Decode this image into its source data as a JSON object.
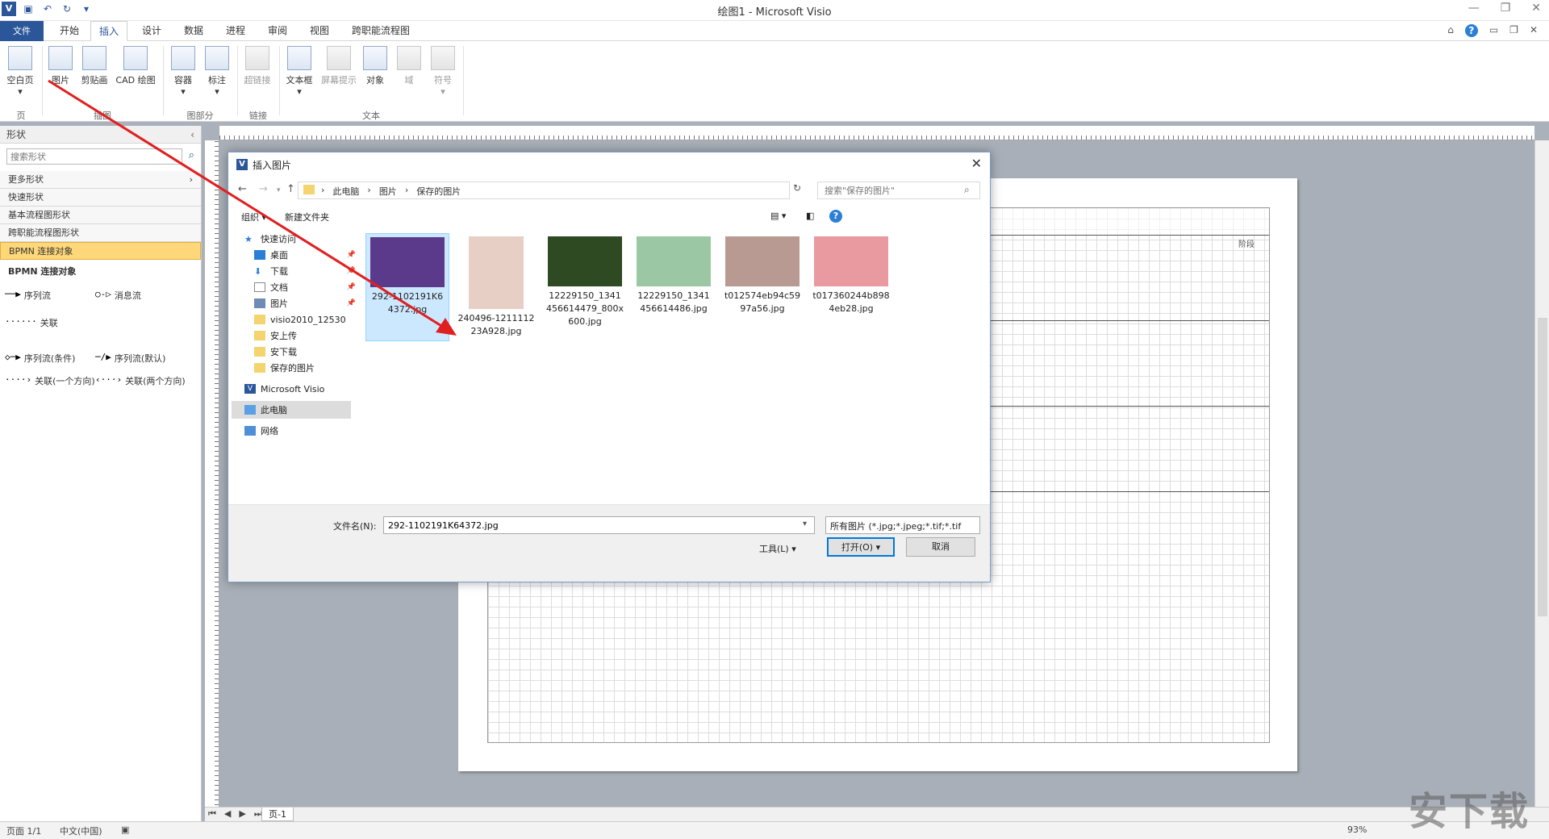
{
  "window": {
    "title": "绘图1 - Microsoft Visio",
    "app_logo": "V"
  },
  "menu": {
    "tabs": [
      "文件",
      "开始",
      "插入",
      "设计",
      "数据",
      "进程",
      "审阅",
      "视图",
      "跨职能流程图"
    ],
    "active_tab": "插入"
  },
  "ribbon": {
    "buttons": {
      "blank_page": "空白页",
      "picture": "图片",
      "clipart": "剪贴画",
      "cad": "CAD 绘图",
      "container": "容器",
      "callout": "标注",
      "hyperlink": "超链接",
      "textbox": "文本框",
      "screentip": "屏幕提示",
      "object": "对象",
      "field": "域",
      "symbol": "符号"
    },
    "groups": {
      "pages": "页",
      "illustrations": "插图",
      "diagram_parts": "图部分",
      "links": "链接",
      "text": "文本"
    }
  },
  "shapes_panel": {
    "header": "形状",
    "search_placeholder": "搜索形状",
    "more_shapes": "更多形状",
    "quick_shapes": "快速形状",
    "basic_flowchart": "基本流程图形状",
    "cross_functional": "跨职能流程图形状",
    "bpmn_selected": "BPMN 连接对象",
    "stencil_title": "BPMN 连接对象",
    "masters": {
      "seq_flow": "序列流",
      "msg_flow": "消息流",
      "assoc": "关联",
      "seq_cond": "序列流(条件)",
      "seq_default": "序列流(默认)",
      "assoc_one": "关联(一个方向)",
      "assoc_two": "关联(两个方向)"
    }
  },
  "diagram": {
    "phase_label": "阶段"
  },
  "dialog": {
    "title": "插入图片",
    "breadcrumb": [
      "此电脑",
      "图片",
      "保存的图片"
    ],
    "search_placeholder": "搜索\"保存的图片\"",
    "organize": "组织 ▾",
    "new_folder": "新建文件夹",
    "nav": {
      "quick_access": "快速访问",
      "desktop": "桌面",
      "downloads": "下载",
      "documents": "文档",
      "pictures": "图片",
      "visio_folder": "visio2010_12530",
      "upload": "安上传",
      "download2": "安下载",
      "saved_pics": "保存的图片",
      "visio": "Microsoft Visio",
      "this_pc": "此电脑",
      "network": "网络"
    },
    "files": [
      {
        "name": "292-1102191K64372.jpg",
        "color": "#5b3a8c"
      },
      {
        "name": "240496-121111223A928.jpg",
        "color": "#e8cfc5"
      },
      {
        "name": "12229150_1341456614479_800x600.jpg",
        "color": "#2e4a22"
      },
      {
        "name": "12229150_1341456614486.jpg",
        "color": "#9bc7a5"
      },
      {
        "name": "t012574eb94c5997a56.jpg",
        "color": "#b89a92"
      },
      {
        "name": "t017360244b8984eb28.jpg",
        "color": "#e89aa0"
      }
    ],
    "filename_label": "文件名(N):",
    "filename_value": "292-1102191K64372.jpg",
    "filter": "所有图片 (*.jpg;*.jpeg;*.tif;*.tif",
    "tools": "工具(L)",
    "open": "打开(O)",
    "cancel": "取消"
  },
  "pagebar": {
    "page_tab": "页-1"
  },
  "status": {
    "page": "页面 1/1",
    "language": "中文(中国)",
    "zoom": "93%"
  },
  "watermark": "安下载"
}
